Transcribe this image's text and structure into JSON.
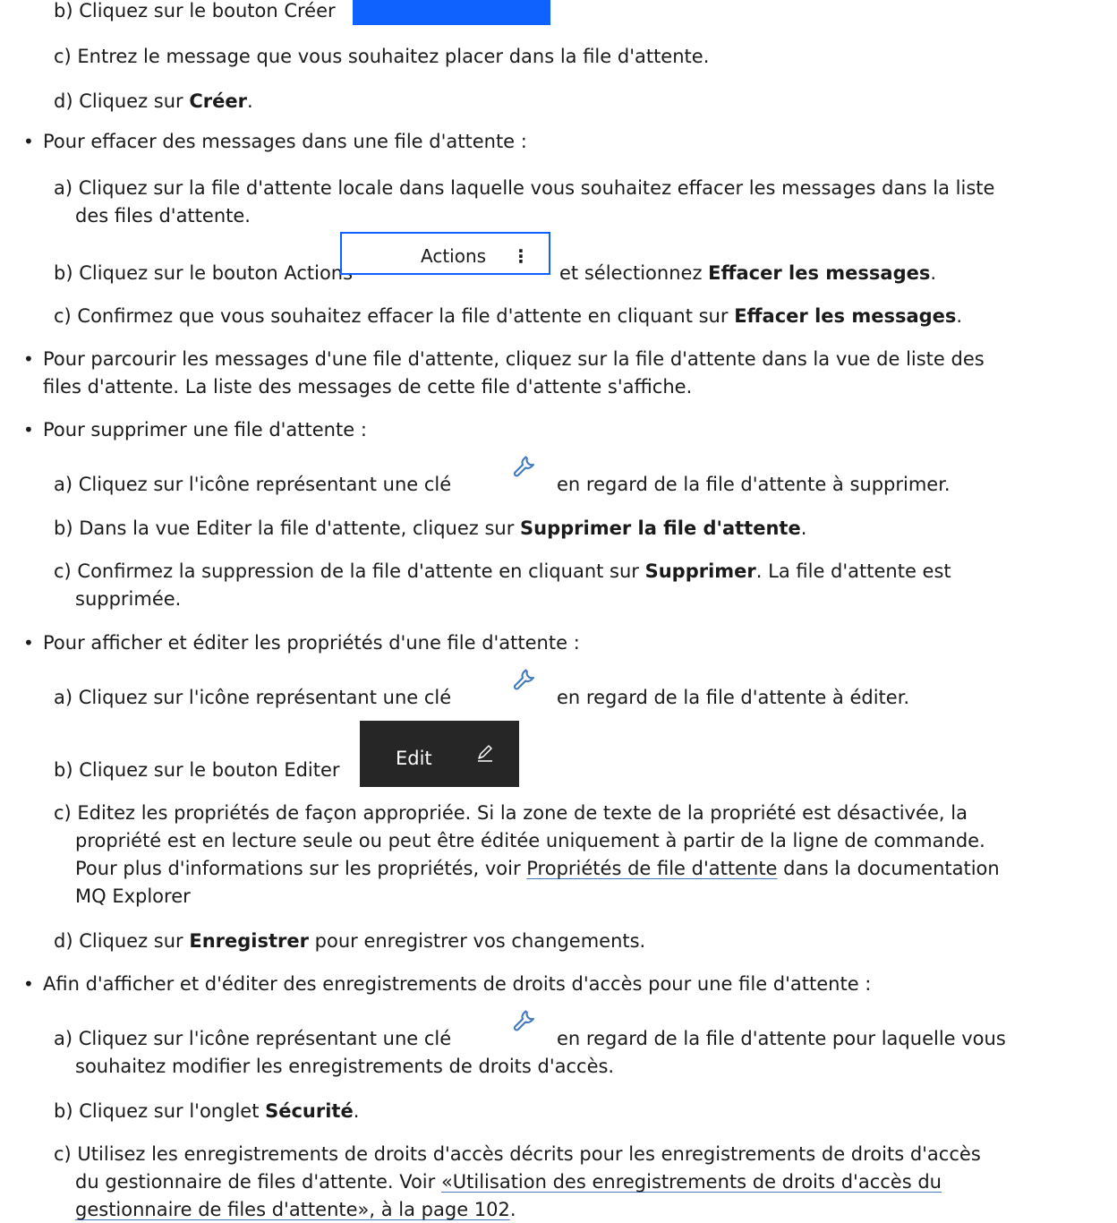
{
  "l1_b": "b) Cliquez sur le bouton Créer",
  "l1_c": "c) Entrez le message que vous souhaitez placer dans la file d'attente.",
  "l1_d_pre": "d) Cliquez sur ",
  "l1_d_bold": "Créer",
  "l1_d_post": ".",
  "bullet": "•",
  "clear_intro": "Pour effacer des messages dans une file d'attente :",
  "clear_a_1": "a) Cliquez sur la file d'attente locale dans laquelle vous souhaitez effacer les messages dans la liste",
  "clear_a_2": "des files d'attente.",
  "clear_b_pre": "b) Cliquez sur le bouton Actions",
  "actions_button_label": "Actions",
  "actions_button_dots": "⋮",
  "clear_b_mid": "et sélectionnez ",
  "clear_b_bold": "Effacer les messages",
  "clear_b_post": ".",
  "clear_c_pre": "c) Confirmez que vous souhaitez effacer la file d'attente en cliquant sur ",
  "clear_c_bold": "Effacer les messages",
  "clear_c_post": ".",
  "browse_1": "Pour parcourir les messages d'une file d'attente, cliquez sur la file d'attente dans la vue de liste des",
  "browse_2": "files d'attente. La liste des messages de cette file d'attente s'affiche.",
  "delete_intro": "Pour supprimer une file d'attente :",
  "delete_a_pre": "a) Cliquez sur l'icône représentant une clé",
  "delete_a_post": "en regard de la file d'attente à supprimer.",
  "delete_b_pre": "b) Dans la vue Editer la file d'attente, cliquez sur ",
  "delete_b_bold": "Supprimer la file d'attente",
  "delete_b_post": ".",
  "delete_c_pre": "c) Confirmez la suppression de la file d'attente en cliquant sur ",
  "delete_c_bold": "Supprimer",
  "delete_c_post": ". La file d'attente est",
  "delete_c_2": "supprimée.",
  "props_intro": "Pour afficher et éditer les propriétés d'une file d'attente :",
  "props_a_pre": "a) Cliquez sur l'icône représentant une clé",
  "props_a_post": "en regard de la file d'attente à éditer.",
  "props_b": "b) Cliquez sur le bouton Editer",
  "edit_button_label": "Edit",
  "props_c_1": "c) Editez les propriétés de façon appropriée. Si la zone de texte de la propriété est désactivée, la",
  "props_c_2": "propriété est en lecture seule ou peut être éditée uniquement à partir de la ligne de commande.",
  "props_c_3_pre": "Pour plus d'informations sur les propriétés, voir ",
  "props_c_3_link": "Propriétés de file d'attente",
  "props_c_3_post": " dans la documentation",
  "props_c_4": "MQ Explorer",
  "props_d_pre": "d) Cliquez sur ",
  "props_d_bold": "Enregistrer",
  "props_d_post": " pour enregistrer vos changements.",
  "auth_intro": "Afin d'afficher et d'éditer des enregistrements de droits d'accès pour une file d'attente :",
  "auth_a_pre": "a) Cliquez sur l'icône représentant une clé",
  "auth_a_post": "en regard de la file d'attente pour laquelle vous",
  "auth_a_2": "souhaitez modifier les enregistrements de droits d'accès.",
  "auth_b_pre": "b) Cliquez sur l'onglet ",
  "auth_b_bold": "Sécurité",
  "auth_b_post": ".",
  "auth_c_1": "c) Utilisez les enregistrements de droits d'accès décrits pour les enregistrements de droits d'accès",
  "auth_c_2_pre": "du gestionnaire de files d'attente. Voir ",
  "auth_c_2_link": "«Utilisation des enregistrements de droits d'accès du",
  "auth_c_3_link": "gestionnaire de files d'attente», à la page 102",
  "auth_c_3_post": ".",
  "colors": {
    "primary_blue": "#0f62fe",
    "edit_button_bg": "#262626",
    "wrench_blue": "#4178be"
  }
}
